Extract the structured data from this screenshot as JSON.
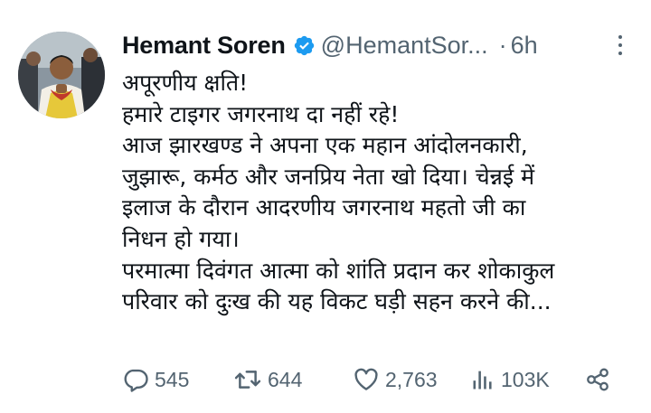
{
  "author": {
    "name": "Hemant Soren",
    "handle": "@HemantSor...",
    "separator": "·",
    "time": "6h"
  },
  "icons": {
    "avatar": "profile-photo",
    "verified": "verified-badge-icon",
    "more": "more-options-icon",
    "reply": "reply-icon",
    "retweet": "retweet-icon",
    "like": "like-icon",
    "views": "views-icon",
    "share": "share-icon"
  },
  "colors": {
    "verified": "#1d9bf0",
    "text": "#0f1419",
    "secondary": "#536471"
  },
  "tweet": {
    "lines": [
      "अपूरणीय क्षति!",
      "हमारे टाइगर जगरनाथ दा नहीं रहे!",
      "आज झारखण्ड ने अपना एक महान आंदोलनकारी,",
      "जुझारू, कर्मठ और जनप्रिय नेता खो दिया। चेन्नई में",
      "इलाज के दौरान आदरणीय जगरनाथ महतो जी का",
      "निधन हो गया।",
      "परमात्मा दिवंगत आत्मा को शांति प्रदान कर शोकाकुल",
      "परिवार को दुःख की यह विकट घड़ी सहन करने की..."
    ]
  },
  "stats": {
    "replies": "545",
    "retweets": "644",
    "likes": "2,763",
    "views": "103K"
  }
}
